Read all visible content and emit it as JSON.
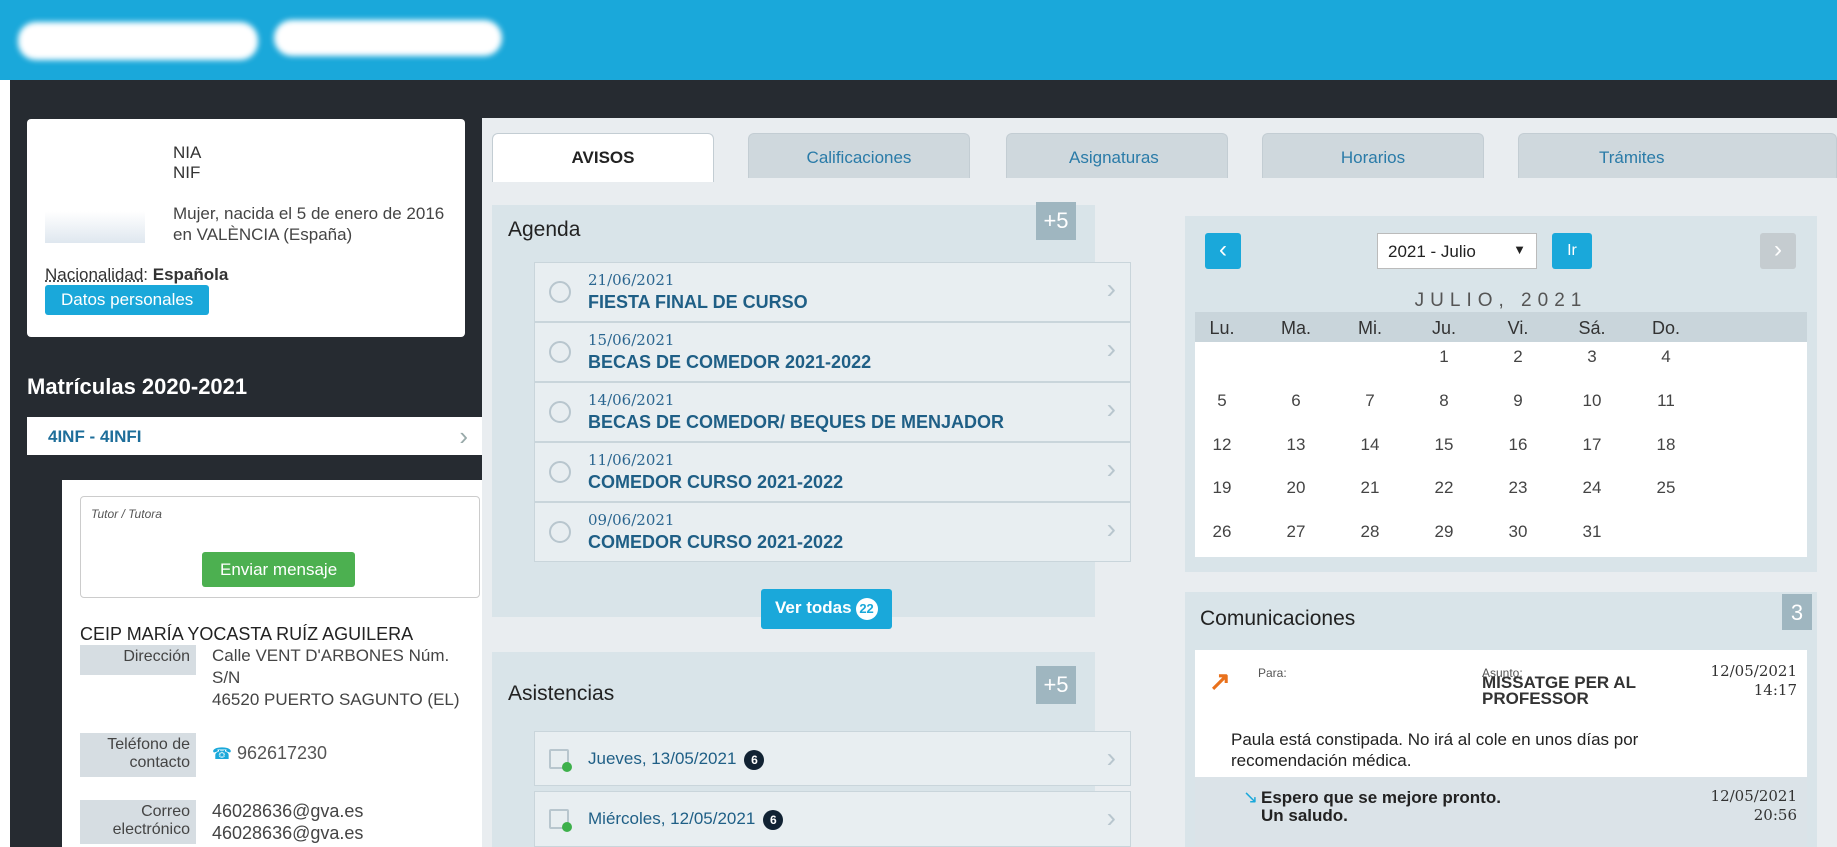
{
  "profile": {
    "nia_label": "NIA",
    "nif_label": "NIF",
    "desc_line1": "Mujer, nacida el 5 de enero de 2016",
    "desc_line2": "en VALÈNCIA (España)",
    "nationality_label": "Nacionalidad",
    "nationality_value": "Española",
    "personal_data_button": "Datos personales"
  },
  "enrollment": {
    "title": "Matrículas 2020-2021",
    "item": "4INF - 4INFI",
    "tutor_label": "Tutor / Tutora",
    "send_message_button": "Enviar mensaje",
    "school_name": "CEIP MARÍA YOCASTA RUÍZ AGUILERA",
    "address_label": "Dirección",
    "address_lines": [
      "Calle VENT D'ARBONES Núm.",
      "S/N",
      "46520 PUERTO SAGUNTO (EL)"
    ],
    "phone_label_1": "Teléfono de",
    "phone_label_2": "contacto",
    "phone": "962617230",
    "email_label_1": "Correo",
    "email_label_2": "electrónico",
    "email_1": "46028636@gva.es",
    "email_2": "46028636@gva.es"
  },
  "tabs": [
    "AVISOS",
    "Calificaciones",
    "Asignaturas",
    "Horarios",
    "Trámites"
  ],
  "agenda": {
    "title": "Agenda",
    "more_badge": "+5",
    "items": [
      {
        "date": "21/06/2021",
        "title": "FIESTA FINAL DE CURSO"
      },
      {
        "date": "15/06/2021",
        "title": "BECAS DE COMEDOR 2021-2022"
      },
      {
        "date": "14/06/2021",
        "title": "BECAS DE COMEDOR/ BEQUES DE MENJADOR"
      },
      {
        "date": "11/06/2021",
        "title": "COMEDOR CURSO 2021-2022"
      },
      {
        "date": "09/06/2021",
        "title": "COMEDOR CURSO 2021-2022"
      }
    ],
    "view_all_button": "Ver todas",
    "view_all_count": "22"
  },
  "attendance": {
    "title": "Asistencias",
    "more_badge": "+5",
    "items": [
      {
        "label": "Jueves, 13/05/2021",
        "count": "6"
      },
      {
        "label": "Miércoles, 12/05/2021",
        "count": "6"
      }
    ]
  },
  "calendar": {
    "selected": "2021 - Julio",
    "go_button": "Ir",
    "month_title": "JULIO, 2021",
    "weekdays": [
      "Lu.",
      "Ma.",
      "Mi.",
      "Ju.",
      "Vi.",
      "Sá.",
      "Do."
    ],
    "weeks": [
      [
        "",
        "",
        "",
        "1",
        "2",
        "3",
        "4"
      ],
      [
        "5",
        "6",
        "7",
        "8",
        "9",
        "10",
        "11"
      ],
      [
        "12",
        "13",
        "14",
        "15",
        "16",
        "17",
        "18"
      ],
      [
        "19",
        "20",
        "21",
        "22",
        "23",
        "24",
        "25"
      ],
      [
        "26",
        "27",
        "28",
        "29",
        "30",
        "31",
        ""
      ]
    ]
  },
  "communications": {
    "title": "Comunicaciones",
    "count_badge": "3",
    "to_label": "Para:",
    "subject_label": "Asunto:",
    "subject": "MISSATGE PER AL PROFESSOR",
    "date": "12/05/2021",
    "time": "14:17",
    "body": "Paula está constipada. No irá al cole en unos días por recomendación médica.",
    "reply_line1": "Espero que se mejore pronto.",
    "reply_line2": "Un saludo.",
    "reply_date": "12/05/2021",
    "reply_time": "20:56"
  },
  "colors": {
    "accent": "#1aa8da",
    "dark": "#262b31",
    "success": "#4cb050",
    "outgoing": "#e9711c"
  }
}
